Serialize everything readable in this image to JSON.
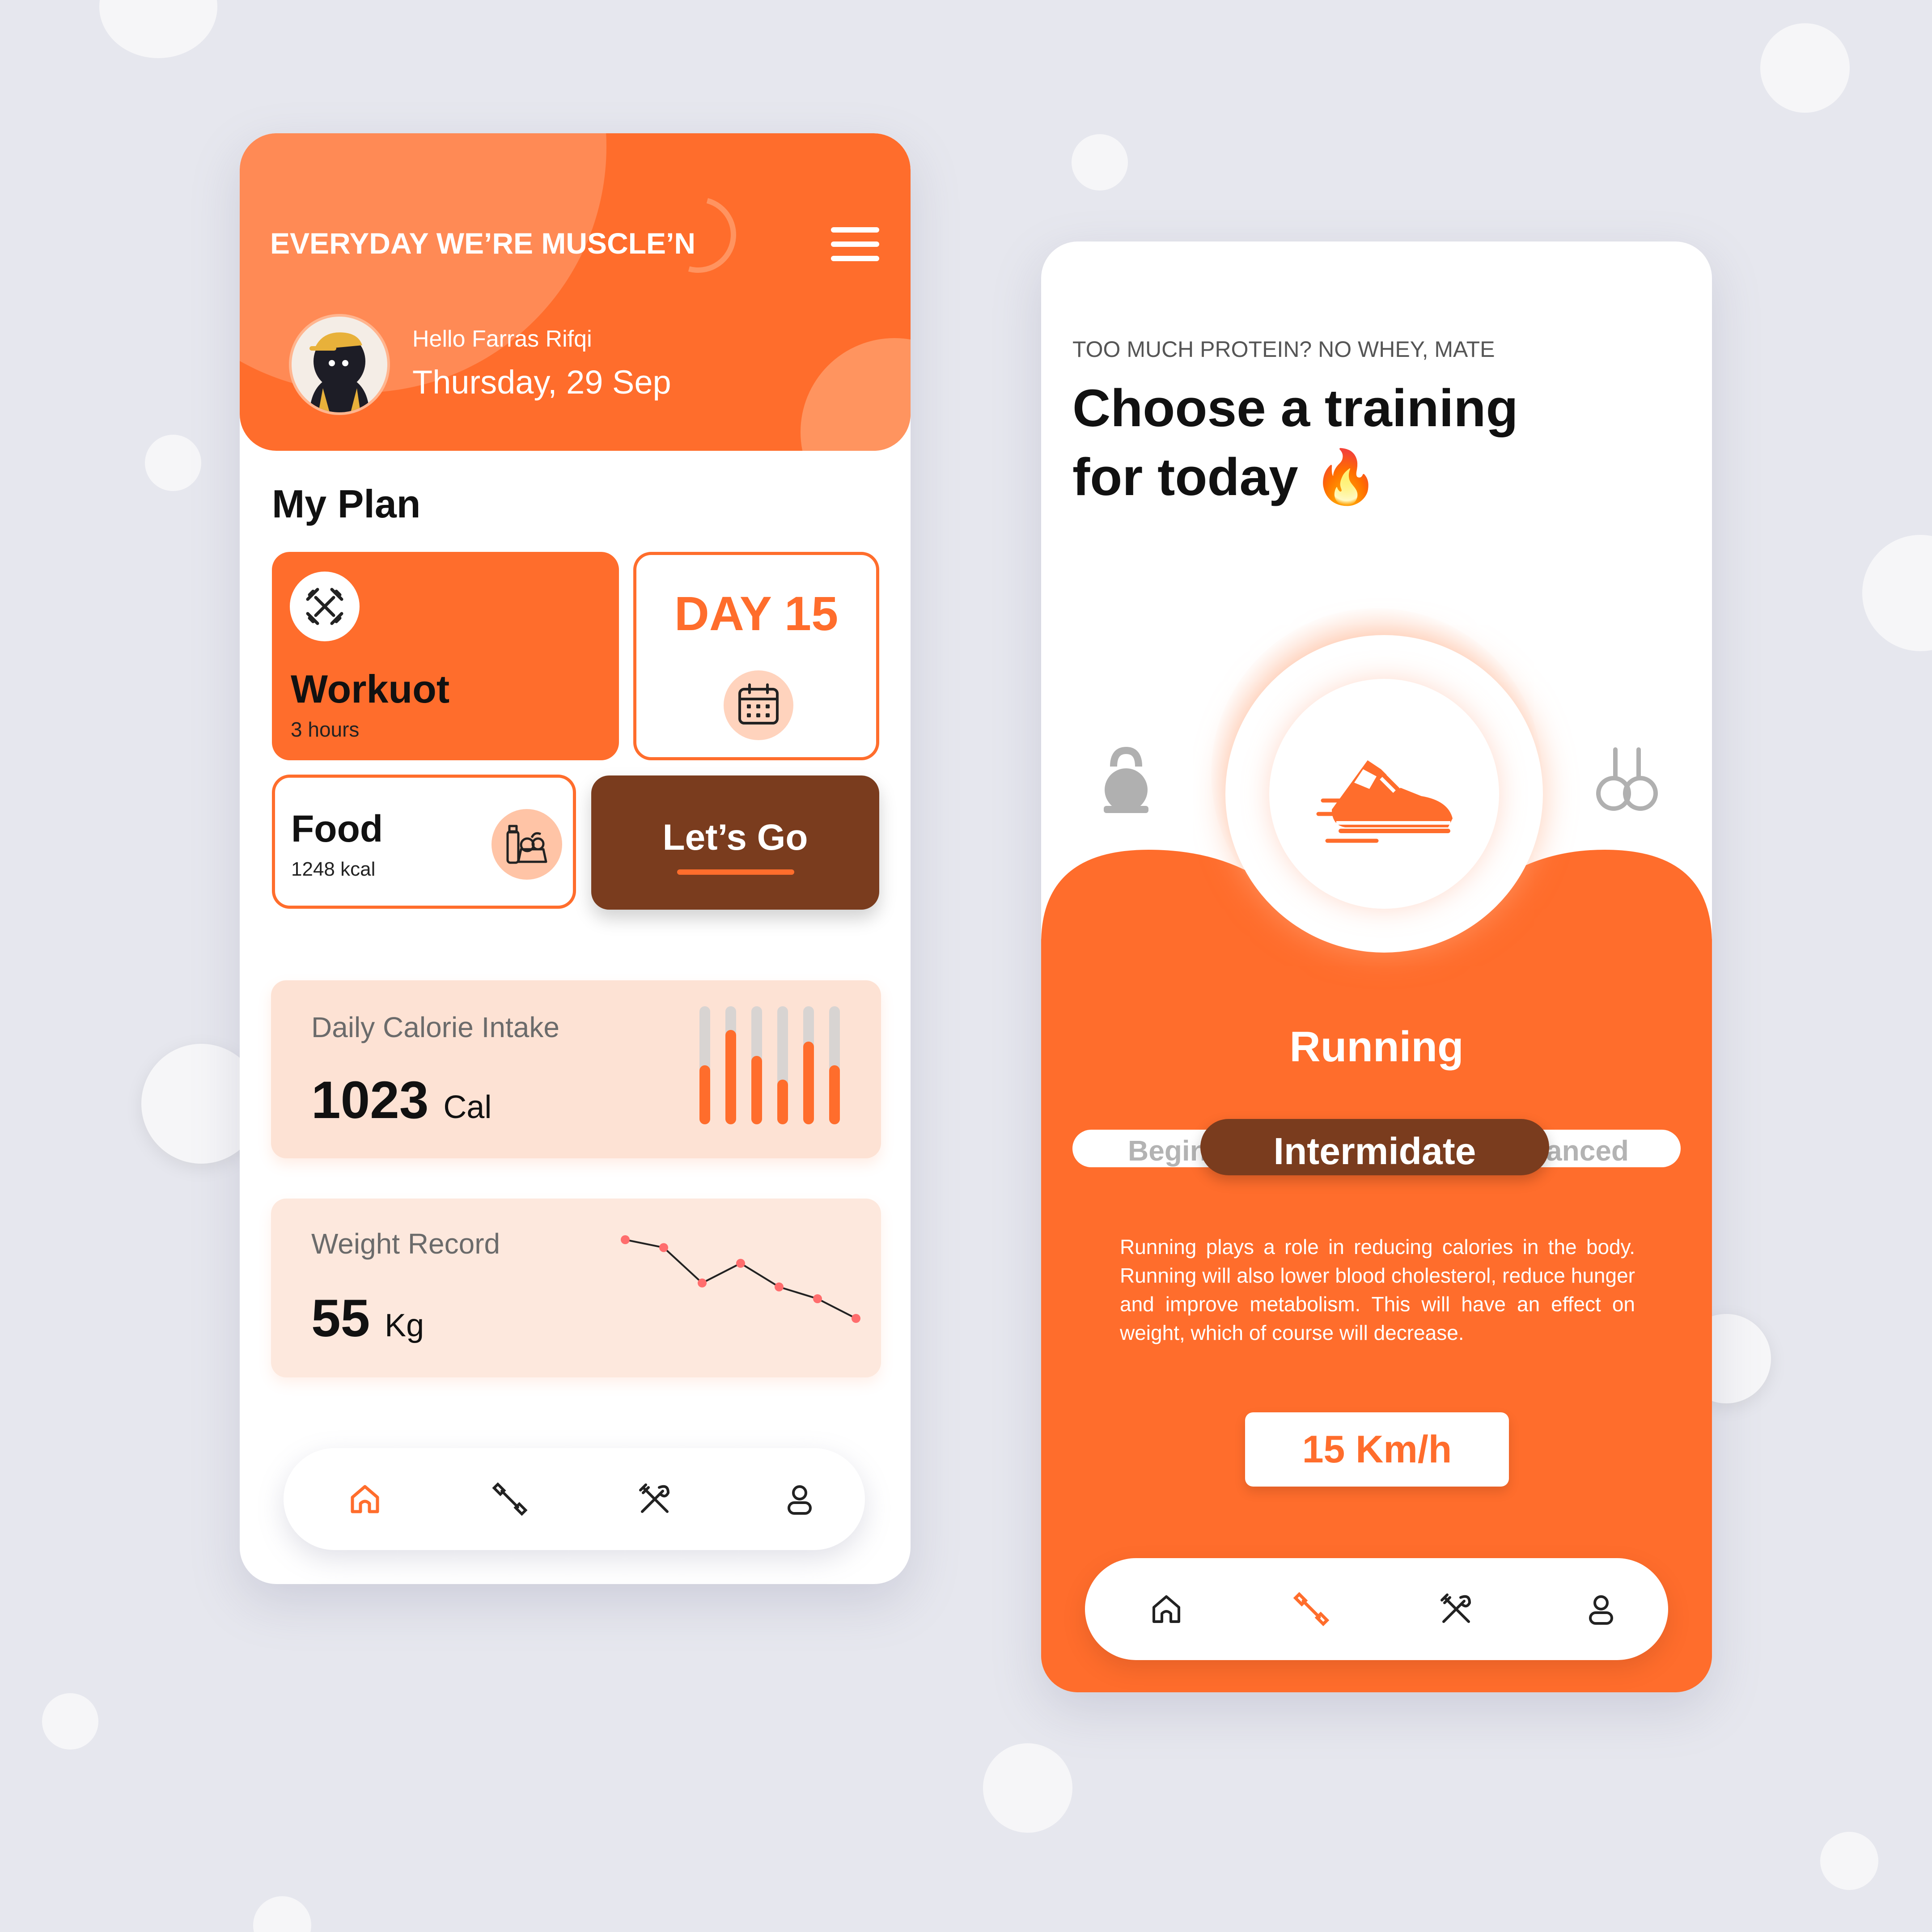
{
  "colors": {
    "accent": "#ff6d2c",
    "accent_dark": "#7a3c1e",
    "background": "#e6e7ee",
    "card_peach": "#fde2d4"
  },
  "home": {
    "brand": "EVERYDAY WE’RE MUSCLE’N",
    "greeting": "Hello Farras Rifqi",
    "date": "Thursday, 29 Sep",
    "section_title": "My Plan",
    "workout": {
      "title": "Workuot",
      "subtitle": "3 hours",
      "icon": "dumbbell-icon"
    },
    "day": {
      "title": "DAY 15",
      "icon": "calendar-icon"
    },
    "food": {
      "title": "Food",
      "subtitle": "1248 kcal",
      "icon": "groceries-icon"
    },
    "cta": "Let’s Go",
    "calorie": {
      "label": "Daily Calorie Intake",
      "value": "1023",
      "unit": "Cal",
      "bar_levels": [
        0.5,
        0.8,
        0.58,
        0.38,
        0.7,
        0.5
      ]
    },
    "weight": {
      "label": "Weight Record",
      "value": "55",
      "unit": "Kg",
      "trend": [
        0.0,
        0.1,
        0.55,
        0.3,
        0.6,
        0.75,
        1.0
      ]
    },
    "nav": [
      "home-icon",
      "dumbbell-icon",
      "utensils-icon",
      "user-icon"
    ],
    "nav_active": 0
  },
  "training": {
    "eyebrow": "TOO MUCH PROTEIN? NO WHEY, MATE",
    "title_line1": "Choose a training",
    "title_line2": "for today",
    "title_emoji": "🔥",
    "options": [
      "kettlebell-icon",
      "running-shoe-icon",
      "gym-rings-icon"
    ],
    "selected": "Running",
    "levels": {
      "left": "Begin",
      "center": "Intermidate",
      "right": "anced"
    },
    "description": "Running plays a role in reducing calories in the body. Running will also lower blood cholesterol, reduce hunger and improve metabolism. This will have an effect on weight, which of course will decrease.",
    "speed": "15 Km/h",
    "nav": [
      "home-icon",
      "dumbbell-icon",
      "utensils-icon",
      "user-icon"
    ],
    "nav_active": 1
  }
}
